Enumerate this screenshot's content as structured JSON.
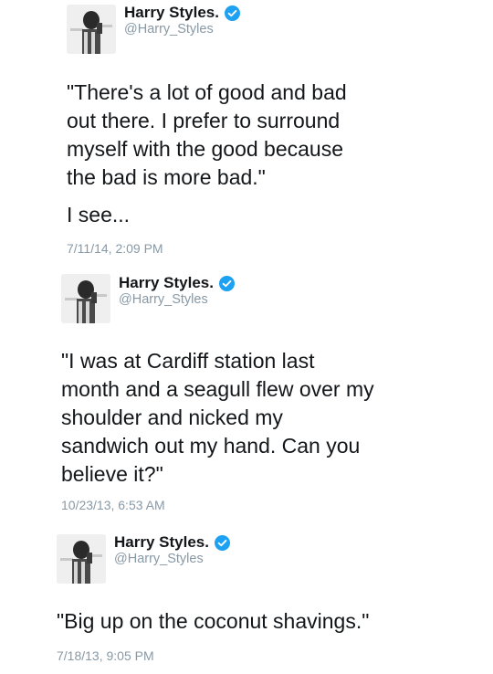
{
  "colors": {
    "text": "#14171a",
    "secondary": "#8899a6",
    "verified": "#1da1f2"
  },
  "tweets": [
    {
      "author": {
        "name": "Harry Styles.",
        "handle": "@Harry_Styles",
        "verified_icon": "verified-badge-icon"
      },
      "text_lines": [
        "\"There's a lot of good and bad",
        "out there. I prefer to surround",
        "myself with the good because",
        "the bad is more bad.\""
      ],
      "extra_line": "I see...",
      "timestamp": "7/11/14, 2:09 PM"
    },
    {
      "author": {
        "name": "Harry Styles.",
        "handle": "@Harry_Styles",
        "verified_icon": "verified-badge-icon"
      },
      "text_lines": [
        "\"I was at Cardiff station last",
        "month and a seagull flew over my",
        "shoulder and nicked my",
        "sandwich out my hand. Can you",
        "believe it?\""
      ],
      "timestamp": "10/23/13, 6:53 AM"
    },
    {
      "author": {
        "name": "Harry Styles.",
        "handle": "@Harry_Styles",
        "verified_icon": "verified-badge-icon"
      },
      "text_lines": [
        "\"Big up on the coconut shavings.\""
      ],
      "timestamp": "7/18/13, 9:05 PM"
    }
  ]
}
